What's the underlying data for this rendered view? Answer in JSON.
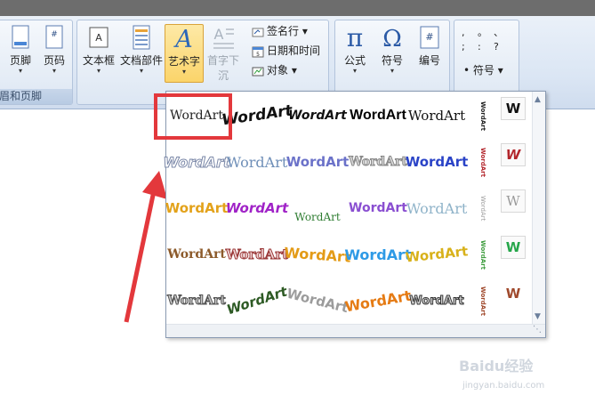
{
  "ribbon": {
    "group1": {
      "buttons": [
        {
          "label": "页脚"
        },
        {
          "label": "页码"
        }
      ],
      "label": "眉和页脚"
    },
    "group2": {
      "buttons": [
        {
          "label": "文本框"
        },
        {
          "label": "文档部件"
        },
        {
          "label": "艺术字"
        },
        {
          "label": "首字下沉"
        }
      ],
      "small": [
        {
          "label": "签名行"
        },
        {
          "label": "日期和时间"
        },
        {
          "label": "对象"
        }
      ]
    },
    "group3": {
      "buttons": [
        {
          "label": "公式"
        },
        {
          "label": "符号"
        },
        {
          "label": "编号"
        }
      ]
    },
    "group4": {
      "symbol_label": "符号",
      "glyphs": [
        ",",
        "。",
        "、",
        ";",
        ":",
        "?"
      ]
    }
  },
  "wordart": {
    "sample_text": "WordArt",
    "side_letter": "W",
    "accent_color": "#e3383c"
  },
  "watermark": {
    "brand": "Baidu经验",
    "url": "jingyan.baidu.com"
  }
}
